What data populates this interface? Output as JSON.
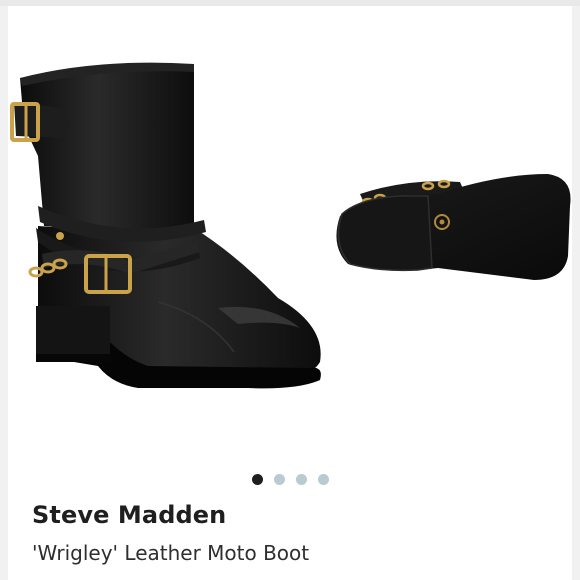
{
  "product": {
    "brand": "Steve Madden",
    "name": "'Wrigley' Leather Moto Boot"
  },
  "carousel": {
    "slide_count": 4,
    "active_index": 0,
    "images": [
      {
        "icon": "boot-side-view-image"
      },
      {
        "icon": "boot-sole-view-image"
      }
    ]
  },
  "colors": {
    "leather": "#111111",
    "hardware": "#c9a24a",
    "dot_active": "#1e1e1e",
    "dot_inactive": "#b7cbd0"
  }
}
